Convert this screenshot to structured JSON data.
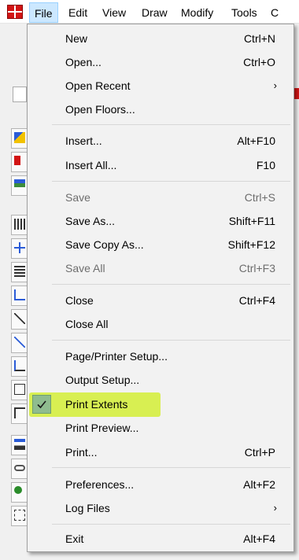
{
  "colors": {
    "menu_bg": "#f2f2f2",
    "highlight": "#d8ef52",
    "check_bg": "#8fbc8f",
    "active_menu_bg": "#cce8ff",
    "app_icon": "#d21414"
  },
  "menubar": {
    "icon": "app-logo-icon",
    "items": [
      {
        "label": "File"
      },
      {
        "label": "Edit"
      },
      {
        "label": "View"
      },
      {
        "label": "Draw"
      },
      {
        "label": "Modify"
      },
      {
        "label": "Tools"
      },
      {
        "label": "C"
      }
    ]
  },
  "file_menu": {
    "items": [
      {
        "label": "New",
        "shortcut": "Ctrl+N"
      },
      {
        "label": "Open...",
        "shortcut": "Ctrl+O"
      },
      {
        "label": "Open Recent",
        "submenu_icon": "chevron-right-icon"
      },
      {
        "label": "Open Floors..."
      },
      {
        "label": "Insert...",
        "shortcut": "Alt+F10"
      },
      {
        "label": "Insert All...",
        "shortcut": "F10"
      },
      {
        "label": "Save",
        "shortcut": "Ctrl+S",
        "disabled": true
      },
      {
        "label": "Save As...",
        "shortcut": "Shift+F11"
      },
      {
        "label": "Save Copy As...",
        "shortcut": "Shift+F12"
      },
      {
        "label": "Save All",
        "shortcut": "Ctrl+F3",
        "disabled": true
      },
      {
        "label": "Close",
        "shortcut": "Ctrl+F4"
      },
      {
        "label": "Close All"
      },
      {
        "label": "Page/Printer Setup..."
      },
      {
        "label": "Output Setup..."
      },
      {
        "label": "Print Extents",
        "checked": true,
        "highlighted": true
      },
      {
        "label": "Print Preview..."
      },
      {
        "label": "Print...",
        "shortcut": "Ctrl+P"
      },
      {
        "label": "Preferences...",
        "shortcut": "Alt+F2"
      },
      {
        "label": "Log Files",
        "submenu_icon": "chevron-right-icon"
      },
      {
        "label": "Exit",
        "shortcut": "Alt+F4"
      }
    ],
    "submenu_arrow": "›"
  }
}
